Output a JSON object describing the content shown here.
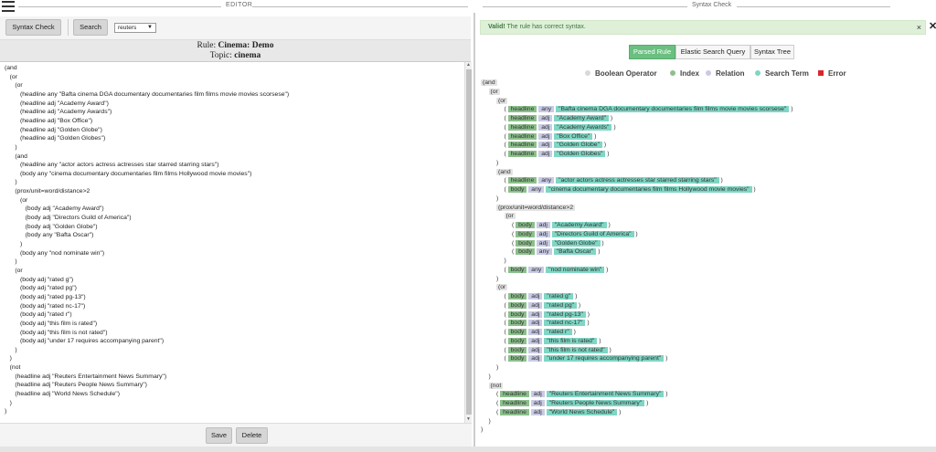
{
  "header": {
    "editor_title": "EDITOR",
    "syntax_title": "Syntax Check"
  },
  "toolbar": {
    "syntax_check": "Syntax Check",
    "search": "Search",
    "source_value": "reuters",
    "source_arrow": "▼"
  },
  "rule": {
    "rule_label": "Rule: ",
    "rule_name": "Cinema: Demo",
    "topic_label": "Topic: ",
    "topic_name": "cinema"
  },
  "code_lines": [
    "(and",
    "   (or",
    "      (or",
    "         (headline any \"Bafta cinema DGA documentary documentaries film films movie movies scorsese\")",
    "         (headline adj \"Academy Award\")",
    "         (headline adj \"Academy Awards\")",
    "         (headline adj \"Box Office\")",
    "         (headline adj \"Golden Globe\")",
    "         (headline adj \"Golden Globes\")",
    "      )",
    "      (and",
    "         (headline any \"actor actors actress actresses star starred starring stars\")",
    "         (body any \"cinema documentary documentaries film films Hollywood movie movies\")",
    "      )",
    "      (prox/unit=word/distance>2",
    "         (or",
    "            (body adj \"Academy Award\")",
    "            (body adj \"Directors Guild of America\")",
    "            (body adj \"Golden Globe\")",
    "            (body any \"Bafta Oscar\")",
    "         )",
    "         (body any \"nod nominate win\")",
    "      )",
    "      (or",
    "         (body adj \"rated g\")",
    "         (body adj \"rated pg\")",
    "         (body adj \"rated pg-13\")",
    "         (body adj \"rated nc-17\")",
    "         (body adj \"rated r\")",
    "         (body adj \"this film is rated\")",
    "         (body adj \"this film is not rated\")",
    "         (body adj \"under 17 requires accompanying parent\")",
    "      )",
    "   )",
    "   (not",
    "      (headline adj \"Reuters Entertainment News Summary\")",
    "      (headline adj \"Reuters People News Summary\")",
    "      (headline adj \"World News Schedule\")",
    "   )",
    ")"
  ],
  "buttons": {
    "save": "Save",
    "delete": "Delete"
  },
  "alert": {
    "strong": "Valid!",
    "text": " The rule has correct syntax.",
    "close": "×"
  },
  "outer_close": "✕",
  "tabs": [
    "Parsed Rule",
    "Elastic Search Query",
    "Syntax Tree"
  ],
  "legend": [
    {
      "label": "Boolean Operator",
      "color": "#d9d9d9",
      "shape": "dot"
    },
    {
      "label": "Index",
      "color": "#8cc08c",
      "shape": "dot"
    },
    {
      "label": "Relation",
      "color": "#c9cbe6",
      "shape": "dot"
    },
    {
      "label": "Search Term",
      "color": "#7fd6c4",
      "shape": "dot"
    },
    {
      "label": "Error",
      "color": "#d9262c",
      "shape": "square"
    }
  ],
  "tree": [
    {
      "indent": 0,
      "op": "and"
    },
    {
      "indent": 1,
      "op": "or"
    },
    {
      "indent": 2,
      "op": "or"
    },
    {
      "indent": 3,
      "idx": "headline",
      "rel": "any",
      "term": "\"Bafta cinema DGA documentary documentaries film films movie movies scorsese\""
    },
    {
      "indent": 3,
      "idx": "headline",
      "rel": "adj",
      "term": "\"Academy Award\""
    },
    {
      "indent": 3,
      "idx": "headline",
      "rel": "adj",
      "term": "\"Academy Awards\""
    },
    {
      "indent": 3,
      "idx": "headline",
      "rel": "adj",
      "term": "\"Box Office\""
    },
    {
      "indent": 3,
      "idx": "headline",
      "rel": "adj",
      "term": "\"Golden Globe\""
    },
    {
      "indent": 3,
      "idx": "headline",
      "rel": "adj",
      "term": "\"Golden Globes\""
    },
    {
      "indent": 2,
      "close": true
    },
    {
      "indent": 2,
      "op": "and"
    },
    {
      "indent": 3,
      "idx": "headline",
      "rel": "any",
      "term": "\"actor actors actress actresses star starred starring stars\""
    },
    {
      "indent": 3,
      "idx": "body",
      "rel": "any",
      "term": "\"cinema documentary documentaries film films Hollywood movie movies\""
    },
    {
      "indent": 2,
      "close": true
    },
    {
      "indent": 2,
      "op": "prox/unit=word/distance>2"
    },
    {
      "indent": 3,
      "op": "or"
    },
    {
      "indent": 4,
      "idx": "body",
      "rel": "adj",
      "term": "\"Academy Award\""
    },
    {
      "indent": 4,
      "idx": "body",
      "rel": "adj",
      "term": "\"Directors Guild of America\""
    },
    {
      "indent": 4,
      "idx": "body",
      "rel": "adj",
      "term": "\"Golden Globe\""
    },
    {
      "indent": 4,
      "idx": "body",
      "rel": "any",
      "term": "\"Bafta Oscar\""
    },
    {
      "indent": 3,
      "close": true
    },
    {
      "indent": 3,
      "idx": "body",
      "rel": "any",
      "term": "\"nod nominate win\""
    },
    {
      "indent": 2,
      "close": true
    },
    {
      "indent": 2,
      "op": "or"
    },
    {
      "indent": 3,
      "idx": "body",
      "rel": "adj",
      "term": "\"rated g\""
    },
    {
      "indent": 3,
      "idx": "body",
      "rel": "adj",
      "term": "\"rated pg\""
    },
    {
      "indent": 3,
      "idx": "body",
      "rel": "adj",
      "term": "\"rated pg-13\""
    },
    {
      "indent": 3,
      "idx": "body",
      "rel": "adj",
      "term": "\"rated nc-17\""
    },
    {
      "indent": 3,
      "idx": "body",
      "rel": "adj",
      "term": "\"rated r\""
    },
    {
      "indent": 3,
      "idx": "body",
      "rel": "adj",
      "term": "\"this film is rated\""
    },
    {
      "indent": 3,
      "idx": "body",
      "rel": "adj",
      "term": "\"this film is not rated\""
    },
    {
      "indent": 3,
      "idx": "body",
      "rel": "adj",
      "term": "\"under 17 requires accompanying parent\""
    },
    {
      "indent": 2,
      "close": true
    },
    {
      "indent": 1,
      "close": true
    },
    {
      "indent": 1,
      "op": "not"
    },
    {
      "indent": 2,
      "idx": "headline",
      "rel": "adj",
      "term": "\"Reuters Entertainment News Summary\""
    },
    {
      "indent": 2,
      "idx": "headline",
      "rel": "adj",
      "term": "\"Reuters People News Summary\""
    },
    {
      "indent": 2,
      "idx": "headline",
      "rel": "adj",
      "term": "\"World News Schedule\""
    },
    {
      "indent": 1,
      "close": true
    },
    {
      "indent": 0,
      "close": true
    }
  ]
}
